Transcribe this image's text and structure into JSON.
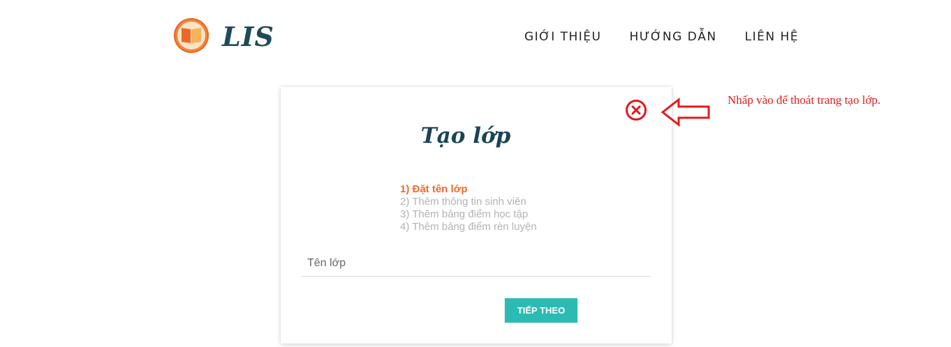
{
  "header": {
    "logo_text": "LIS",
    "nav": [
      "GIỚI THIỆU",
      "HƯỚNG DẪN",
      "LIÊN HỆ"
    ]
  },
  "modal": {
    "title": "Tạo lớp",
    "steps": [
      "1) Đặt tên lớp",
      "2) Thêm thông tin sinh viên",
      "3) Thêm bảng điểm học tập",
      "4) Thêm bảng điểm rèn luyện"
    ],
    "active_step": 0,
    "class_name_placeholder": "Tên lớp",
    "class_name_value": "",
    "next_label": "TIẾP THEO"
  },
  "annotation": {
    "text": "Nhấp vào để thoát trang tạo lớp."
  },
  "colors": {
    "accent_teal": "#2bbbb3",
    "active_step": "#f06a2a",
    "annotation_red": "#e31b1b"
  }
}
